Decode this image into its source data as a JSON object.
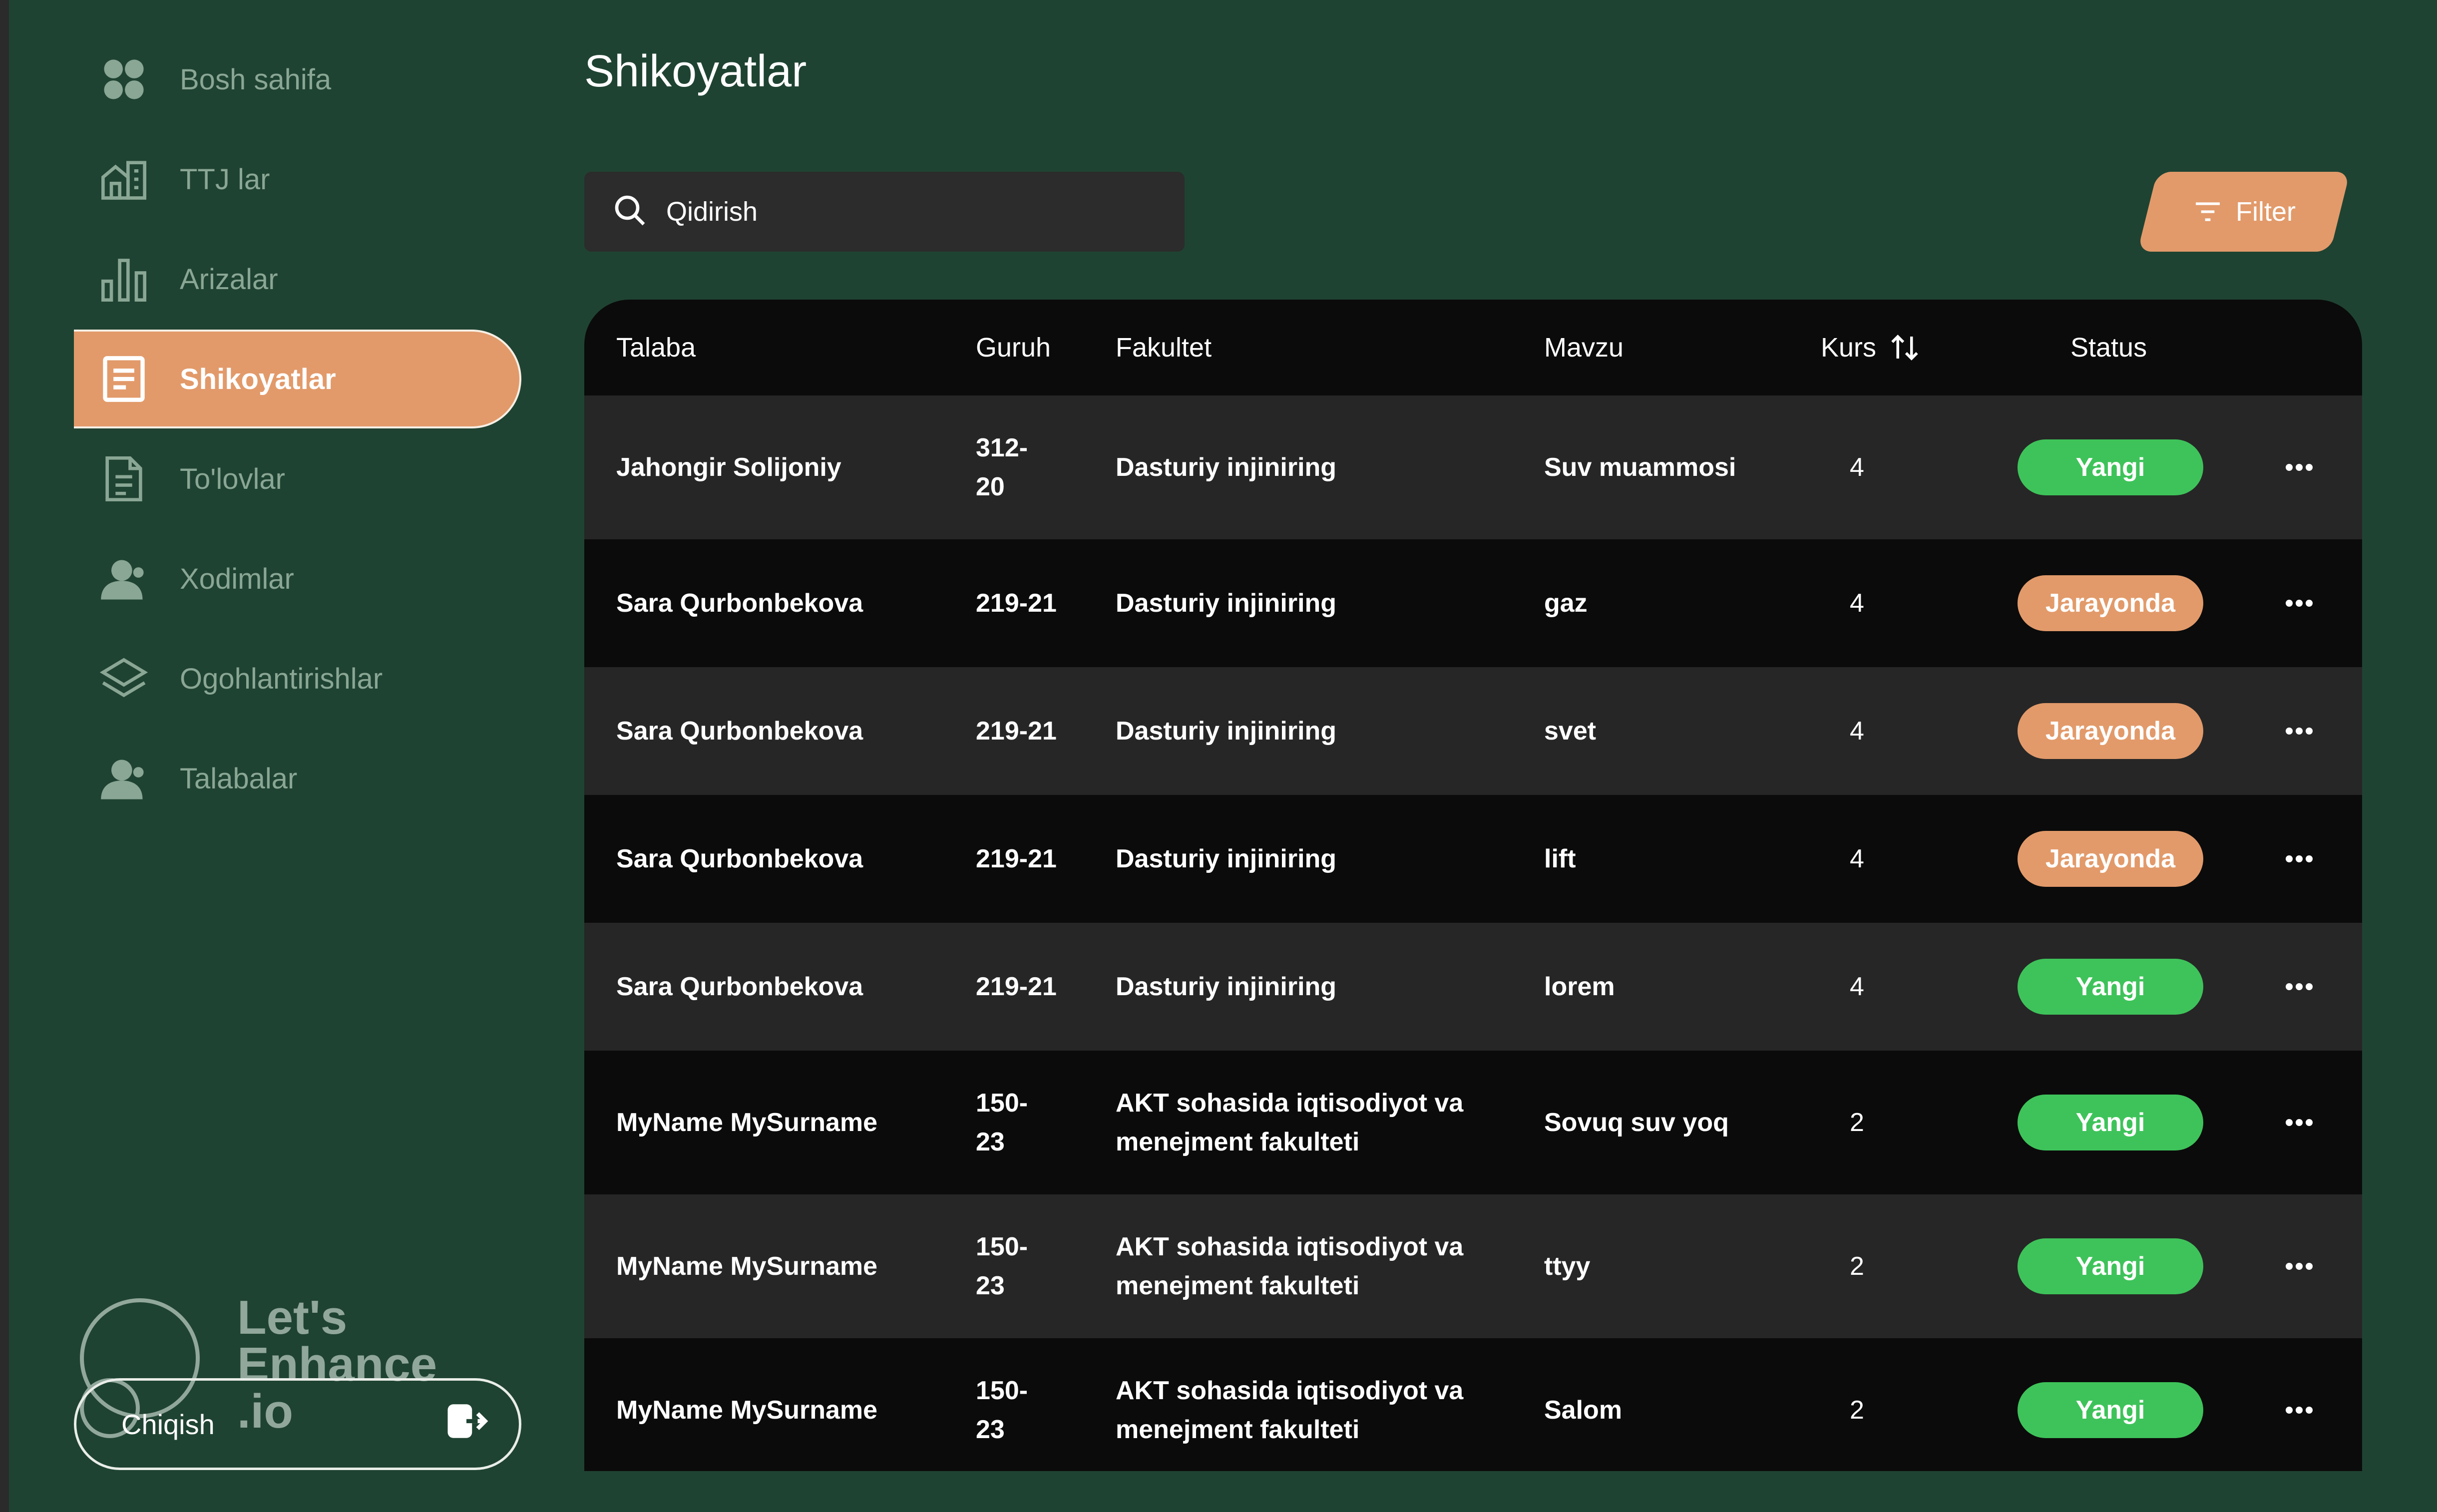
{
  "sidebar": {
    "items": [
      {
        "label": "Bosh sahifa",
        "icon": "dashboard-icon"
      },
      {
        "label": "TTJ lar",
        "icon": "building-icon"
      },
      {
        "label": "Arizalar",
        "icon": "bar-chart-icon"
      },
      {
        "label": "Shikoyatlar",
        "icon": "document-icon",
        "active": true
      },
      {
        "label": "To'lovlar",
        "icon": "file-icon"
      },
      {
        "label": "Xodimlar",
        "icon": "user-icon"
      },
      {
        "label": "Ogohlantirishlar",
        "icon": "layers-icon"
      },
      {
        "label": "Talabalar",
        "icon": "user-icon"
      }
    ],
    "logout_label": "Chiqish"
  },
  "watermark": {
    "line1": "Let's",
    "line2": "Enhance",
    "line3": ".io"
  },
  "page": {
    "title": "Shikoyatlar"
  },
  "search": {
    "placeholder": "Qidirish"
  },
  "filter": {
    "label": "Filter"
  },
  "table": {
    "columns": [
      "Talaba",
      "Guruh",
      "Fakultet",
      "Mavzu",
      "Kurs",
      "Status"
    ],
    "rows": [
      {
        "talaba": "Jahongir  Solijoniy",
        "guruh": "312-\n20",
        "fakultet": "Dasturiy injiniring",
        "mavzu": "Suv muammosi",
        "kurs": "4",
        "status": "Yangi"
      },
      {
        "talaba": "Sara  Qurbonbekova",
        "guruh": "219-21",
        "fakultet": "Dasturiy injiniring",
        "mavzu": "gaz",
        "kurs": "4",
        "status": "Jarayonda"
      },
      {
        "talaba": "Sara  Qurbonbekova",
        "guruh": "219-21",
        "fakultet": "Dasturiy injiniring",
        "mavzu": "svet",
        "kurs": "4",
        "status": "Jarayonda"
      },
      {
        "talaba": "Sara  Qurbonbekova",
        "guruh": "219-21",
        "fakultet": "Dasturiy injiniring",
        "mavzu": "lift",
        "kurs": "4",
        "status": "Jarayonda"
      },
      {
        "talaba": "Sara  Qurbonbekova",
        "guruh": "219-21",
        "fakultet": "Dasturiy injiniring",
        "mavzu": "lorem",
        "kurs": "4",
        "status": "Yangi"
      },
      {
        "talaba": "MyName  MySurname",
        "guruh": "150-\n23",
        "fakultet": "AKT sohasida iqtisodiyot va\nmenejment fakulteti",
        "mavzu": "Sovuq suv yoq",
        "kurs": "2",
        "status": "Yangi"
      },
      {
        "talaba": "MyName  MySurname",
        "guruh": "150-\n23",
        "fakultet": "AKT sohasida iqtisodiyot va\nmenejment fakulteti",
        "mavzu": "ttyy",
        "kurs": "2",
        "status": "Yangi"
      },
      {
        "talaba": "MyName  MySurname",
        "guruh": "150-\n23",
        "fakultet": "AKT sohasida iqtisodiyot va\nmenejment fakulteti",
        "mavzu": "Salom",
        "kurs": "2",
        "status": "Yangi"
      }
    ]
  },
  "colors": {
    "background": "#1f4332",
    "accent": "#e29a6a",
    "status_new": "#3ec35a",
    "status_in_progress": "#e29a6a"
  }
}
